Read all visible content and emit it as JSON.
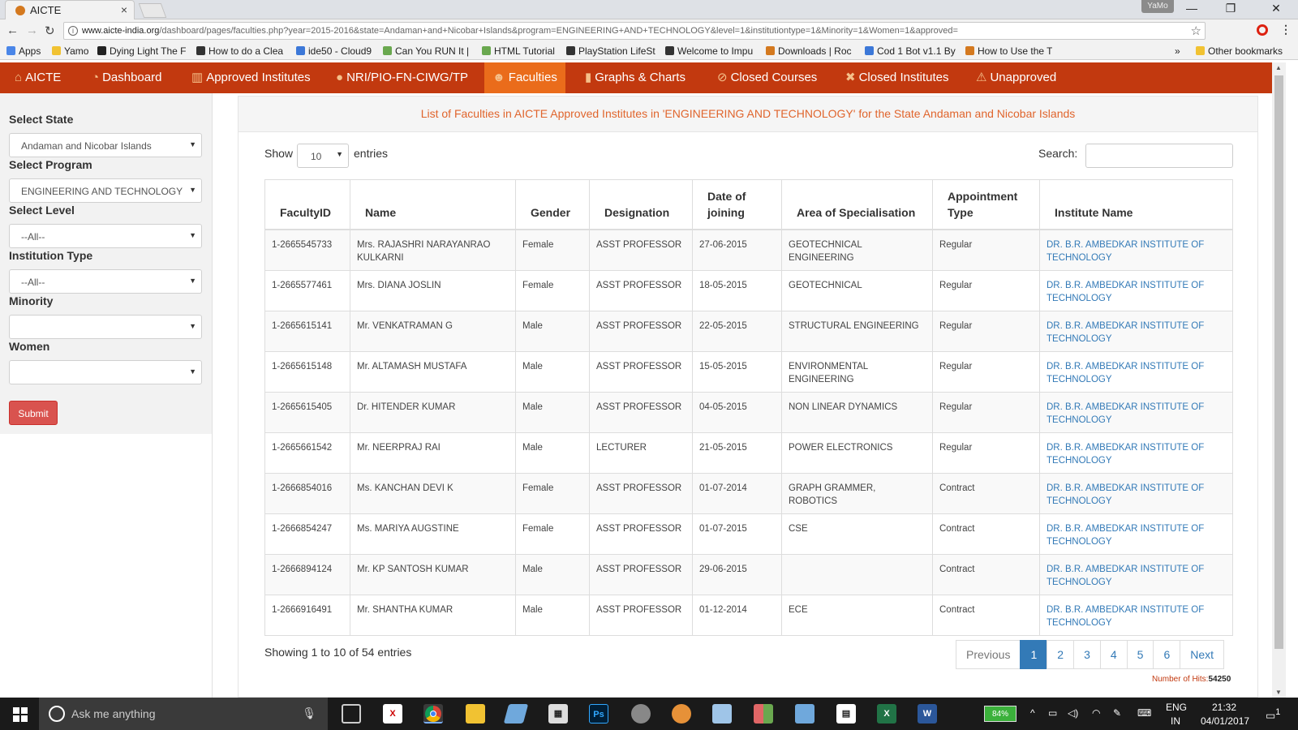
{
  "browser": {
    "tab_title": "AICTE",
    "profile": "YaMo",
    "url_domain": "www.aicte-india.org",
    "url_path": "/dashboard/pages/faculties.php?year=2015-2016&state=Andaman+and+Nicobar+Islands&program=ENGINEERING+AND+TECHNOLOGY&level=1&institutiontype=1&Minority=1&Women=1&approved=",
    "bookmarks": [
      "Apps",
      "Yamo",
      "Dying Light The F",
      "How to do a Clea",
      "ide50 - Cloud9",
      "Can You RUN It |",
      "HTML Tutorial",
      "PlayStation LifeSt",
      "Welcome to Impu",
      "Downloads | Roc",
      "Cod 1 Bot v1.1 By",
      "How to Use the T"
    ],
    "bookmarks_more": "»",
    "other_bookmarks": "Other bookmarks"
  },
  "nav": [
    {
      "icon": "home-icon",
      "glyph": "⌂",
      "label": "AICTE"
    },
    {
      "icon": "dashboard-icon",
      "glyph": "◔",
      "label": "Dashboard"
    },
    {
      "icon": "institution-icon",
      "glyph": "▥",
      "label": "Approved Institutes"
    },
    {
      "icon": "globe-icon",
      "glyph": "●",
      "label": "NRI/PIO-FN-CIWG/TP"
    },
    {
      "icon": "users-icon",
      "glyph": "☻",
      "label": "Faculties"
    },
    {
      "icon": "bar-chart-icon",
      "glyph": "▮",
      "label": "Graphs & Charts"
    },
    {
      "icon": "ban-icon",
      "glyph": "⊘",
      "label": "Closed Courses"
    },
    {
      "icon": "times-icon",
      "glyph": "✖",
      "label": "Closed Institutes"
    },
    {
      "icon": "warning-icon",
      "glyph": "⚠",
      "label": "Unapproved"
    }
  ],
  "filters": {
    "state_label": "Select State",
    "state_value": "Andaman and Nicobar Islands",
    "program_label": "Select Program",
    "program_value": "ENGINEERING AND TECHNOLOGY",
    "level_label": "Select Level",
    "level_value": "--All--",
    "type_label": "Institution Type",
    "type_value": "--All--",
    "minority_label": "Minority",
    "minority_value": "",
    "women_label": "Women",
    "women_value": "",
    "submit_label": "Submit"
  },
  "main": {
    "heading": "List of Faculties in AICTE Approved Institutes in 'ENGINEERING AND TECHNOLOGY' for the State Andaman and Nicobar Islands",
    "show_label": "Show",
    "page_length": "10",
    "entries_label": "entries",
    "search_label": "Search:",
    "columns": [
      "FacultyID",
      "Name",
      "Gender",
      "Designation",
      "Date of joining",
      "Area of Specialisation",
      "Appointment Type",
      "Institute Name"
    ],
    "rows": [
      [
        "1-2665545733",
        "Mrs. RAJASHRI NARAYANRAO KULKARNI",
        "Female",
        "ASST PROFESSOR",
        "27-06-2015",
        "GEOTECHNICAL ENGINEERING",
        "Regular",
        "DR. B.R. AMBEDKAR INSTITUTE OF TECHNOLOGY"
      ],
      [
        "1-2665577461",
        "Mrs. DIANA JOSLIN",
        "Female",
        "ASST PROFESSOR",
        "18-05-2015",
        "GEOTECHNICAL",
        "Regular",
        "DR. B.R. AMBEDKAR INSTITUTE OF TECHNOLOGY"
      ],
      [
        "1-2665615141",
        "Mr. VENKATRAMAN G",
        "Male",
        "ASST PROFESSOR",
        "22-05-2015",
        "STRUCTURAL ENGINEERING",
        "Regular",
        "DR. B.R. AMBEDKAR INSTITUTE OF TECHNOLOGY"
      ],
      [
        "1-2665615148",
        "Mr. ALTAMASH MUSTAFA",
        "Male",
        "ASST PROFESSOR",
        "15-05-2015",
        "ENVIRONMENTAL ENGINEERING",
        "Regular",
        "DR. B.R. AMBEDKAR INSTITUTE OF TECHNOLOGY"
      ],
      [
        "1-2665615405",
        "Dr. HITENDER KUMAR",
        "Male",
        "ASST PROFESSOR",
        "04-05-2015",
        "NON LINEAR DYNAMICS",
        "Regular",
        "DR. B.R. AMBEDKAR INSTITUTE OF TECHNOLOGY"
      ],
      [
        "1-2665661542",
        "Mr. NEERPRAJ RAI",
        "Male",
        "LECTURER",
        "21-05-2015",
        "POWER ELECTRONICS",
        "Regular",
        "DR. B.R. AMBEDKAR INSTITUTE OF TECHNOLOGY"
      ],
      [
        "1-2666854016",
        "Ms. KANCHAN DEVI K",
        "Female",
        "ASST PROFESSOR",
        "01-07-2014",
        "GRAPH GRAMMER, ROBOTICS",
        "Contract",
        "DR. B.R. AMBEDKAR INSTITUTE OF TECHNOLOGY"
      ],
      [
        "1-2666854247",
        "Ms. MARIYA AUGSTINE",
        "Female",
        "ASST PROFESSOR",
        "01-07-2015",
        "CSE",
        "Contract",
        "DR. B.R. AMBEDKAR INSTITUTE OF TECHNOLOGY"
      ],
      [
        "1-2666894124",
        "Mr. KP SANTOSH KUMAR",
        "Male",
        "ASST PROFESSOR",
        "29-06-2015",
        "",
        "Contract",
        "DR. B.R. AMBEDKAR INSTITUTE OF TECHNOLOGY"
      ],
      [
        "1-2666916491",
        "Mr. SHANTHA KUMAR",
        "Male",
        "ASST PROFESSOR",
        "01-12-2014",
        "ECE",
        "Contract",
        "DR. B.R. AMBEDKAR INSTITUTE OF TECHNOLOGY"
      ]
    ],
    "info": "Showing 1 to 10 of 54 entries",
    "pager": {
      "prev": "Previous",
      "pages": [
        "1",
        "2",
        "3",
        "4",
        "5",
        "6"
      ],
      "current": "1",
      "next": "Next"
    },
    "hits_label": "Number of Hits:",
    "hits_value": "54250"
  },
  "taskbar": {
    "search_placeholder": "Ask me anything",
    "battery": "84%",
    "lang": "ENG",
    "region": "IN",
    "time": "21:32",
    "date": "04/01/2017",
    "notifications": "1"
  },
  "colors": {
    "nav_bg": "#c2390f",
    "nav_active": "#ea6c1b",
    "heading": "#e0652d",
    "link": "#337ab7",
    "submit": "#d9534f"
  }
}
